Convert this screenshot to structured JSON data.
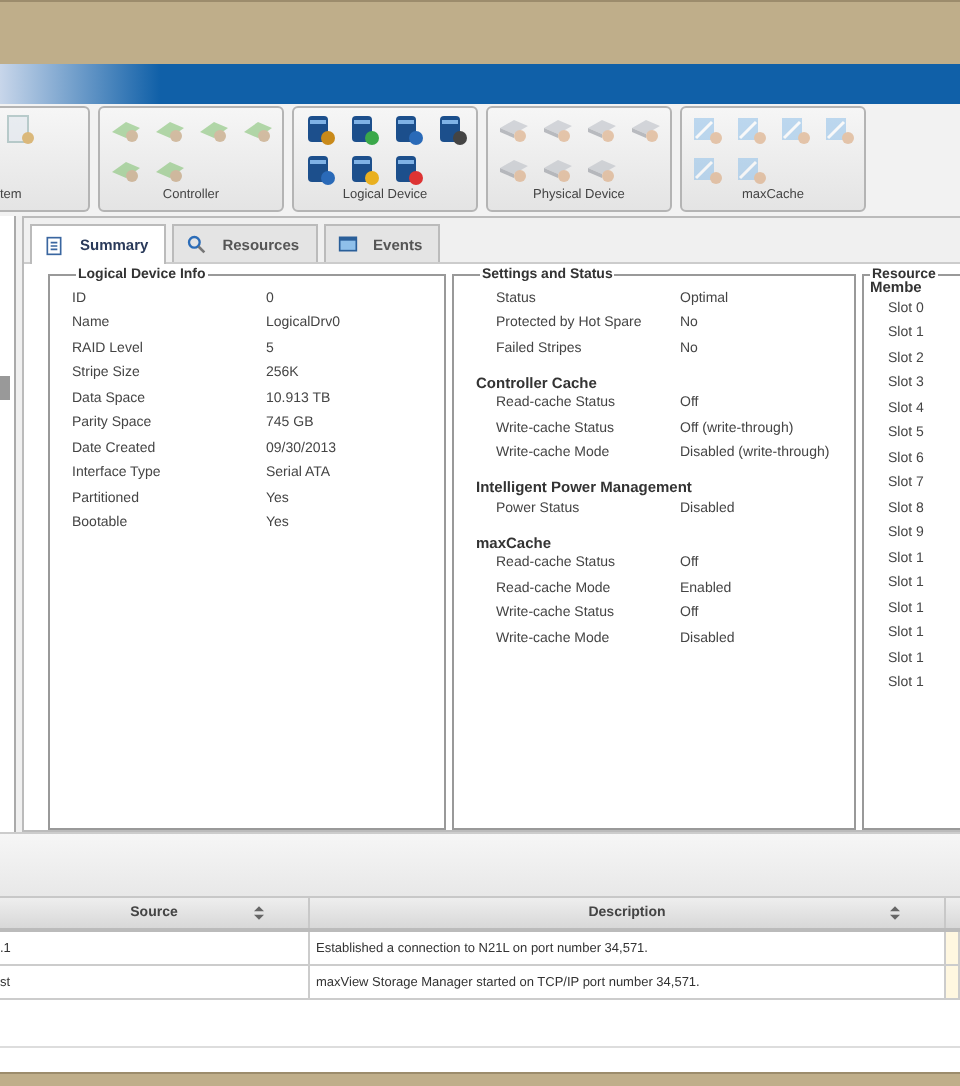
{
  "toolbar": {
    "groups": [
      {
        "label": "tem",
        "kind": "system",
        "disabled": true
      },
      {
        "label": "Controller",
        "kind": "controller",
        "disabled": true
      },
      {
        "label": "Logical Device",
        "kind": "logical",
        "disabled": false
      },
      {
        "label": "Physical Device",
        "kind": "physical",
        "disabled": true
      },
      {
        "label": "maxCache",
        "kind": "maxcache",
        "disabled": true
      }
    ]
  },
  "tabs": [
    {
      "label": "Summary",
      "kind": "document",
      "selected": true
    },
    {
      "label": "Resources",
      "kind": "search",
      "selected": false
    },
    {
      "label": "Events",
      "kind": "window",
      "selected": false
    }
  ],
  "logical_device_info": {
    "title": "Logical Device Info",
    "rows": [
      {
        "label": "ID",
        "value": "0"
      },
      {
        "label": "Name",
        "value": "LogicalDrv0"
      },
      {
        "label": "RAID Level",
        "value": "5"
      },
      {
        "label": "Stripe Size",
        "value": "256K"
      },
      {
        "label": "Data Space",
        "value": "10.913 TB"
      },
      {
        "label": "Parity Space",
        "value": "745 GB"
      },
      {
        "label": "Date Created",
        "value": "09/30/2013"
      },
      {
        "label": "Interface Type",
        "value": "Serial ATA"
      },
      {
        "label": "Partitioned",
        "value": "Yes"
      },
      {
        "label": "Bootable",
        "value": "Yes"
      }
    ]
  },
  "settings_and_status": {
    "title": "Settings and Status",
    "sections": [
      {
        "rows": [
          {
            "label": "Status",
            "value": "Optimal"
          },
          {
            "label": "Protected by Hot Spare",
            "value": "No"
          },
          {
            "label": "Failed Stripes",
            "value": "No"
          }
        ]
      },
      {
        "heading": "Controller Cache",
        "rows": [
          {
            "label": "Read-cache Status",
            "value": "Off"
          },
          {
            "label": "Write-cache Status",
            "value": "Off (write-through)"
          },
          {
            "label": "Write-cache Mode",
            "value": "Disabled (write-through)"
          }
        ]
      },
      {
        "heading": "Intelligent Power Management",
        "rows": [
          {
            "label": "Power Status",
            "value": "Disabled"
          }
        ]
      },
      {
        "heading": "maxCache",
        "rows": [
          {
            "label": "Read-cache Status",
            "value": "Off"
          },
          {
            "label": "Read-cache Mode",
            "value": "Enabled"
          },
          {
            "label": "Write-cache Status",
            "value": "Off"
          },
          {
            "label": "Write-cache Mode",
            "value": "Disabled"
          }
        ]
      }
    ]
  },
  "resources": {
    "title": "Resource",
    "heading": "Membe",
    "items": [
      "Slot 0",
      "Slot 1",
      "Slot 2",
      "Slot 3",
      "Slot 4",
      "Slot 5",
      "Slot 6",
      "Slot 7",
      "Slot 8",
      "Slot 9",
      "Slot 1",
      "Slot 1",
      "Slot 1",
      "Slot 1",
      "Slot 1",
      "Slot 1"
    ]
  },
  "events_table": {
    "columns": [
      "Source",
      "Description"
    ],
    "rows": [
      {
        "source": ".1",
        "description": "Established a connection to N21L on port number 34,571."
      },
      {
        "source": "st",
        "description": "maxView Storage Manager started on TCP/IP port number 34,571."
      }
    ]
  }
}
